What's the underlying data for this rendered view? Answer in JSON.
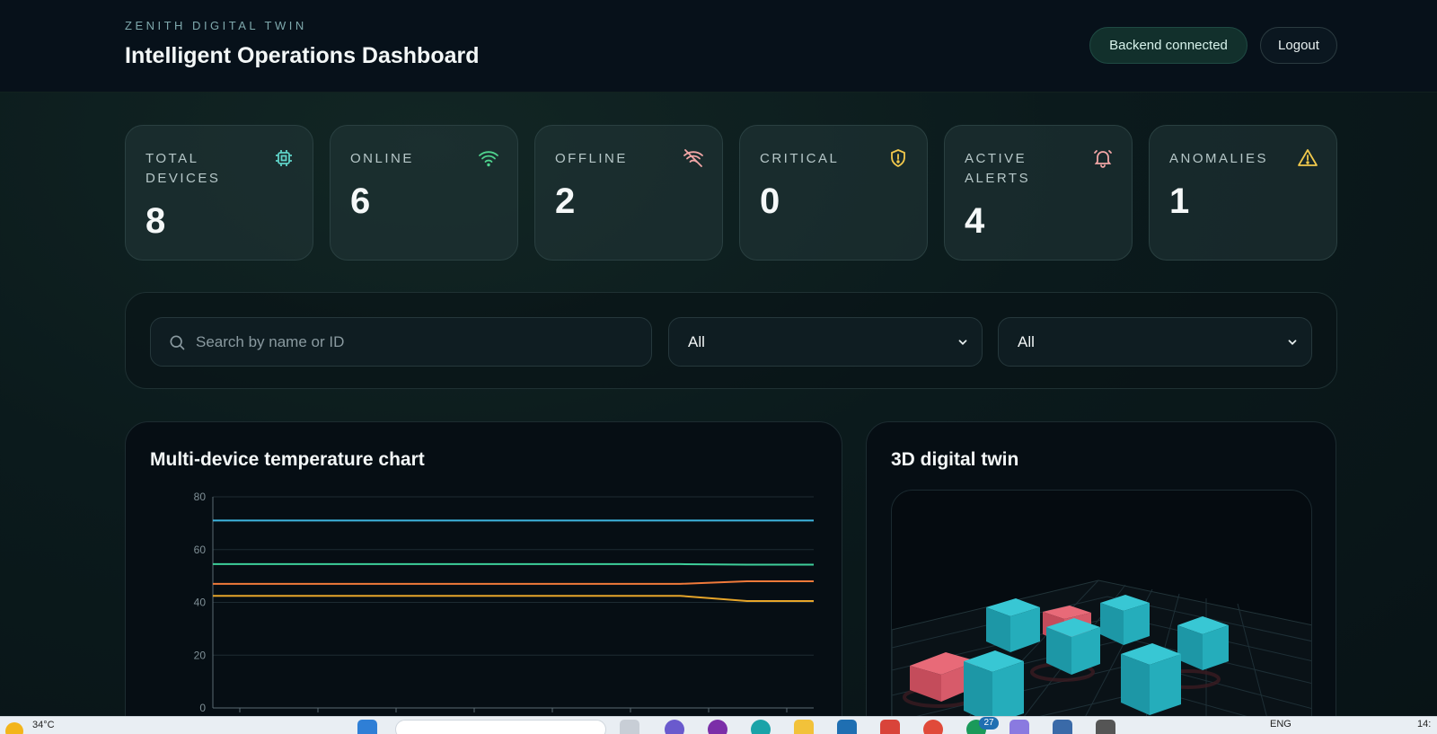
{
  "header": {
    "kicker": "ZENITH DIGITAL TWIN",
    "title": "Intelligent Operations Dashboard",
    "status": "Backend connected",
    "logout": "Logout"
  },
  "stats": [
    {
      "label": "TOTAL DEVICES",
      "value": "8",
      "icon": "chip-icon",
      "color": "#5fd3c8"
    },
    {
      "label": "ONLINE",
      "value": "6",
      "icon": "wifi-icon",
      "color": "#4fd38e"
    },
    {
      "label": "OFFLINE",
      "value": "2",
      "icon": "wifi-off-icon",
      "color": "#f2a6a6"
    },
    {
      "label": "CRITICAL",
      "value": "0",
      "icon": "shield-alert-icon",
      "color": "#f2c94c"
    },
    {
      "label": "ACTIVE ALERTS",
      "value": "4",
      "icon": "bell-alert-icon",
      "color": "#f2a6a6"
    },
    {
      "label": "ANOMALIES",
      "value": "1",
      "icon": "warning-triangle-icon",
      "color": "#f2c94c"
    }
  ],
  "filters": {
    "search_placeholder": "Search by name or ID",
    "status_select": "All",
    "type_select": "All"
  },
  "chart_panel": {
    "title": "Multi-device temperature chart"
  },
  "twin_panel": {
    "title": "3D digital twin"
  },
  "chart_data": {
    "type": "line",
    "title": "Multi-device temperature chart",
    "ylim": [
      0,
      80
    ],
    "yticks": [
      0,
      20,
      40,
      60,
      80
    ],
    "grid": true,
    "series": [
      {
        "color": "#3fb6e0",
        "values": [
          71,
          71,
          71,
          71,
          71,
          71,
          71,
          71,
          71,
          71
        ]
      },
      {
        "color": "#3ecf9a",
        "values": [
          54.5,
          54.5,
          54.5,
          54.5,
          54.5,
          54.5,
          54.5,
          54.5,
          54.3,
          54.3
        ]
      },
      {
        "color": "#f07a3a",
        "values": [
          47,
          47,
          47,
          47,
          47,
          47,
          47,
          47,
          48,
          48
        ]
      },
      {
        "color": "#e6a52a",
        "values": [
          42.5,
          42.5,
          42.5,
          42.5,
          42.5,
          42.5,
          42.5,
          42.5,
          40.5,
          40.5
        ]
      }
    ]
  },
  "taskbar": {
    "temperature": "34°C",
    "badge": "27",
    "lang": "ENG",
    "time": "14:"
  }
}
